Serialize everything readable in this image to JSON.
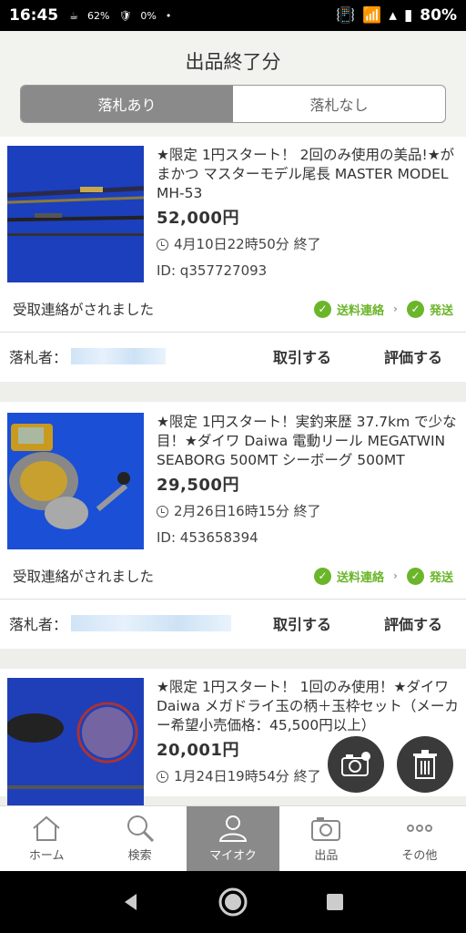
{
  "status_bar": {
    "time": "16:45",
    "percent_small": "62%",
    "zero": "0%",
    "battery": "80%"
  },
  "header": {
    "title": "出品終了分",
    "seg_with_bid": "落札あり",
    "seg_no_bid": "落札なし"
  },
  "items": [
    {
      "title": "★限定 1円スタート！ 2回のみ使用の美品!★がまかつ マスターモデル尾長 MASTER MODEL MH-53",
      "price": "52,000円",
      "end_time": "4月10日22時50分 終了",
      "id_label": "ID: q357727093",
      "status": "受取連絡がされました",
      "step1": "送料連絡",
      "step2": "発送",
      "bidder_label": "落札者：",
      "trade": "取引する",
      "rate": "評価する"
    },
    {
      "title": "★限定 1円スタート！実釣来歴 37.7km で少な目！★ダイワ Daiwa 電動リール MEGATWIN SEABORG 500MT シーボーグ 500MT",
      "price": "29,500円",
      "end_time": "2月26日16時15分 終了",
      "id_label": "ID: 453658394",
      "status": "受取連絡がされました",
      "step1": "送料連絡",
      "step2": "発送",
      "bidder_label": "落札者：",
      "trade": "取引する",
      "rate": "評価する"
    },
    {
      "title": "★限定 1円スタート！ 1回のみ使用！★ダイワ Daiwa メガドライ玉の柄＋玉枠セット（メーカー希望小売価格：45,500円以上）",
      "price": "20,001円",
      "end_time": "1月24日19時54分 終了"
    }
  ],
  "tabs": [
    {
      "label": "ホーム",
      "icon": "home-icon"
    },
    {
      "label": "検索",
      "icon": "search-icon"
    },
    {
      "label": "マイオク",
      "icon": "person-icon"
    },
    {
      "label": "出品",
      "icon": "camera-icon"
    },
    {
      "label": "その他",
      "icon": "more-icon"
    }
  ],
  "colors": {
    "accent_green": "#6bb52a",
    "active_tab": "#8a8a8a"
  }
}
